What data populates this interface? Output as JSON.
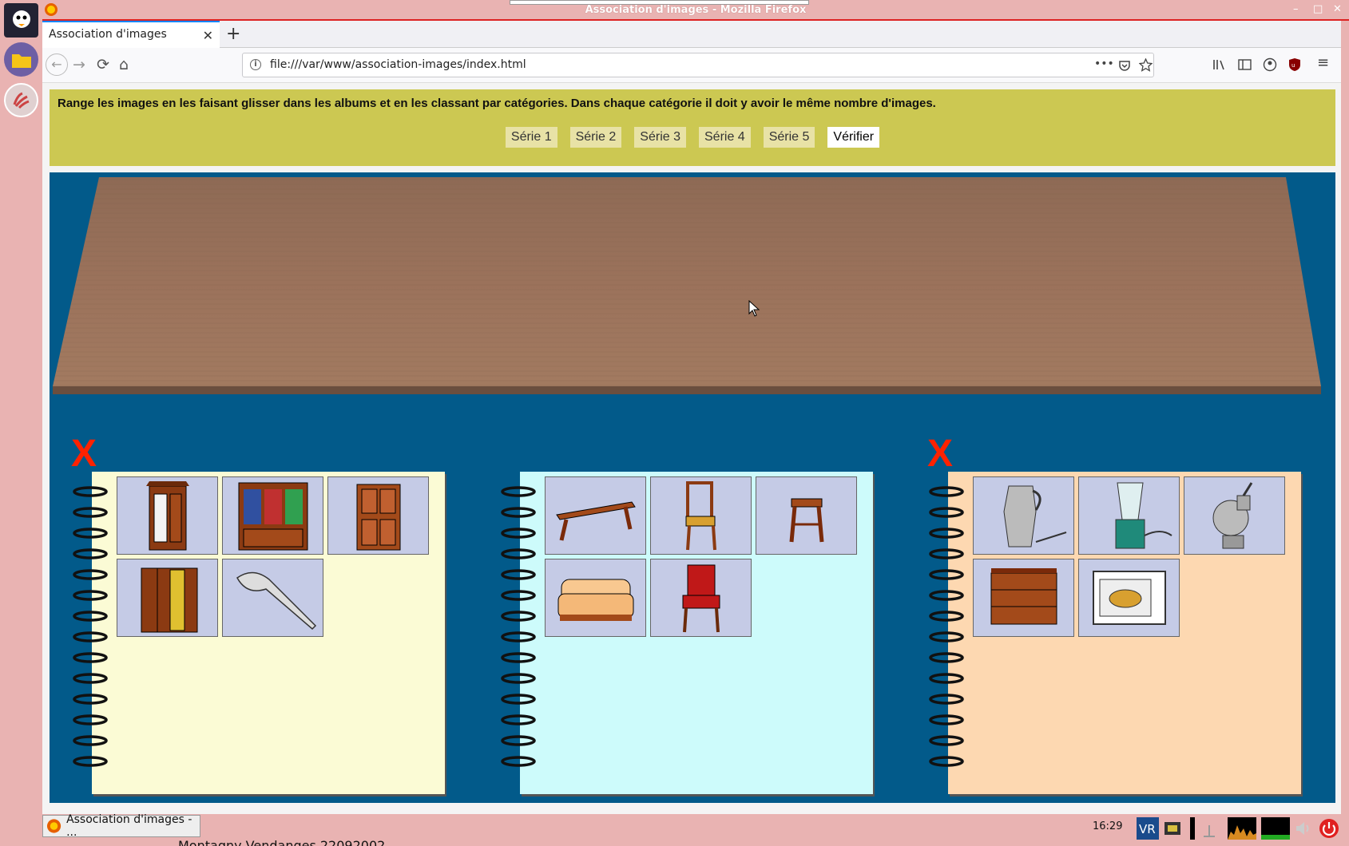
{
  "window": {
    "title": "Association d'images - Mozilla Firefox",
    "min": "–",
    "max": "□",
    "close": "✕"
  },
  "tab": {
    "label": "Association d'images",
    "close": "✕",
    "new": "+"
  },
  "nav": {
    "url": "file:///var/www/association-images/index.html",
    "back": "←",
    "forward": "→",
    "reload": "⟳",
    "home": "⌂",
    "more": "•••",
    "menu": "≡"
  },
  "page": {
    "instructions": "Range les images en les faisant glisser dans les albums et en les classant par catégories. Dans chaque catégorie il doit y avoir le même nombre d'images.",
    "series": [
      "Série 1",
      "Série 2",
      "Série 3",
      "Série 4",
      "Série 5"
    ],
    "verify": "Vérifier"
  },
  "albums": [
    {
      "color": "#fbfbd5",
      "marked_wrong": true,
      "items": [
        "wardrobe",
        "bookcase",
        "cabinet",
        "armoire",
        "electric-knife"
      ]
    },
    {
      "color": "#cdfbfb",
      "marked_wrong": false,
      "items": [
        "bench",
        "chair",
        "stool",
        "sofa",
        "armchair"
      ]
    },
    {
      "color": "#fdd8b1",
      "marked_wrong": true,
      "items": [
        "coffee-pot",
        "blender",
        "meat-grinder",
        "dresser",
        "oven"
      ]
    }
  ],
  "marks": {
    "wrong": "X"
  },
  "taskbar": {
    "item": "Association d'images - ...",
    "clock": "16:29",
    "behind_text": "Montagny Vendanges 22092002"
  }
}
